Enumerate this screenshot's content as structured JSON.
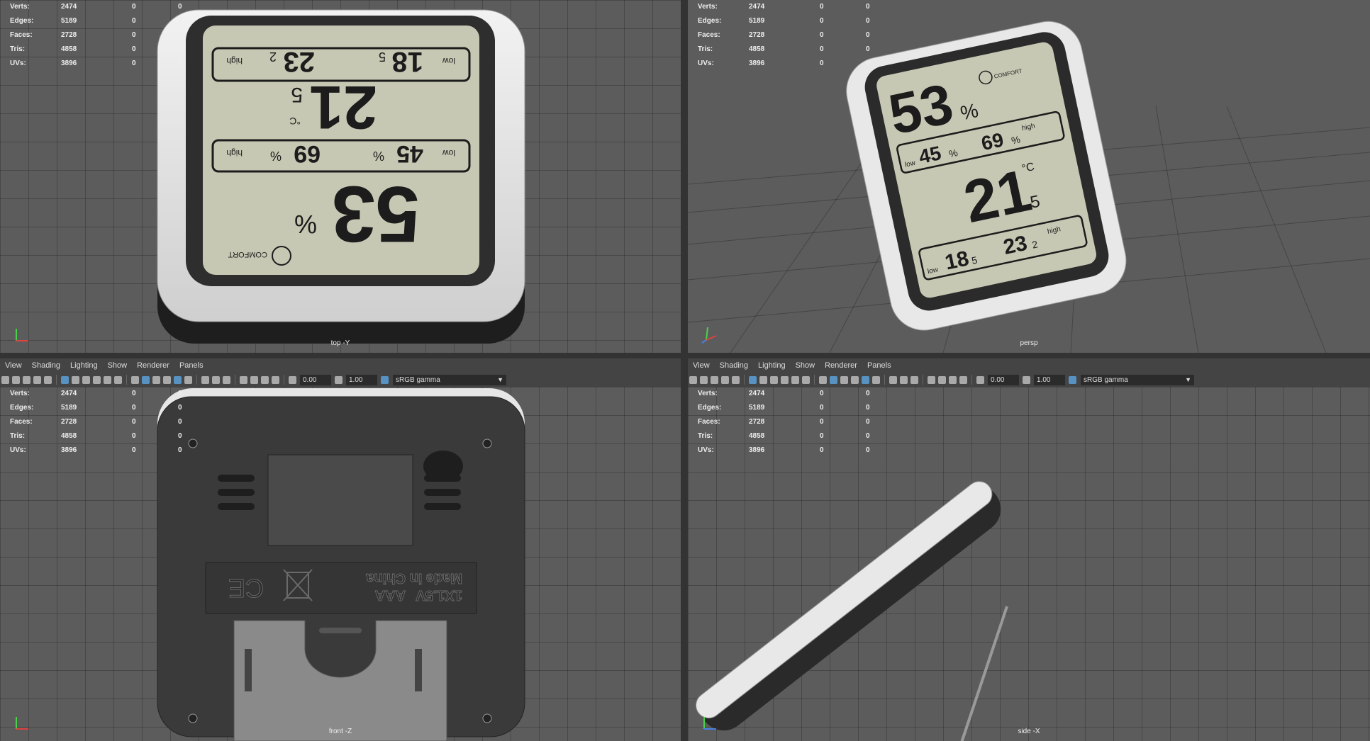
{
  "stats": {
    "labels": [
      "Verts:",
      "Edges:",
      "Faces:",
      "Tris:",
      "UVs:"
    ],
    "values": [
      [
        "2474",
        "0",
        "0"
      ],
      [
        "5189",
        "0",
        "0"
      ],
      [
        "2728",
        "0",
        "0"
      ],
      [
        "4858",
        "0",
        "0"
      ],
      [
        "3896",
        "0",
        "0"
      ]
    ]
  },
  "menu": [
    "View",
    "Shading",
    "Lighting",
    "Show",
    "Renderer",
    "Panels"
  ],
  "toolbar": {
    "exposure": "0.00",
    "gamma_value": "1.00",
    "color_space": "sRGB gamma",
    "dropdown_icon": "chevron-down-icon"
  },
  "viewports": {
    "top": {
      "camera": "top -Y"
    },
    "persp": {
      "camera": "persp"
    },
    "front": {
      "camera": "front -Z"
    },
    "side": {
      "camera": "side -X"
    }
  },
  "lcd": {
    "high_label": "high",
    "low_label": "low",
    "high_temp": "23",
    "high_temp_dec": "2",
    "low_temp": "18",
    "low_temp_dec": "5",
    "temp_unit": "°C",
    "temp": "21",
    "temp_dec": "5",
    "humidity_low": "45",
    "humidity_high": "69",
    "pct": "%",
    "humidity": "53",
    "comfort": "COMFORT"
  },
  "back_label": {
    "voltage": "1X1.5V",
    "battery": "AAA",
    "origin": "Made in China",
    "ce": "CE"
  }
}
